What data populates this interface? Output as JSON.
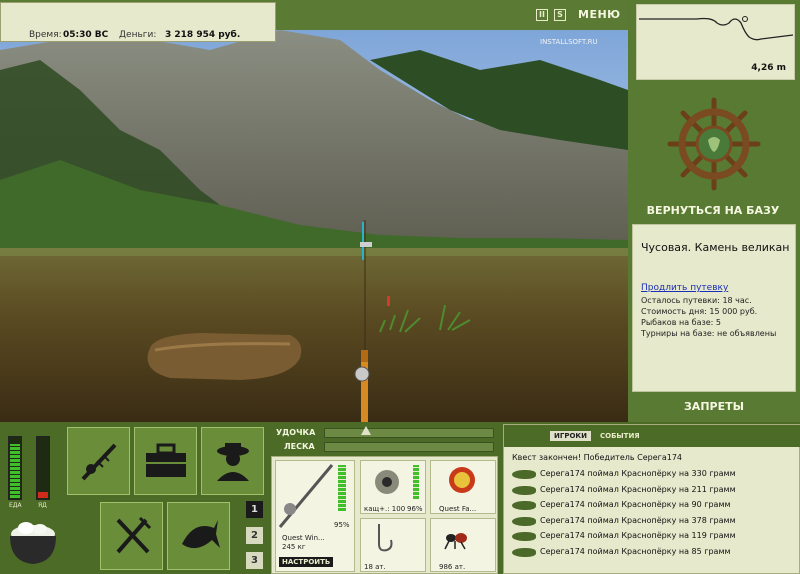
{
  "hud": {
    "time_label": "Время:",
    "time_value": "05:30 ВС",
    "money_label": "Деньги:",
    "money_value": "3 218 954 руб."
  },
  "top_controls": {
    "pause_symbol": "II",
    "sound_symbol": "S",
    "menu_label": "МЕНЮ"
  },
  "watermark": "INSTALLSOFT.RU",
  "depth": {
    "value": "4,26 m"
  },
  "right_panel": {
    "return_label": "ВЕРНУТЬСЯ НА БАЗУ",
    "location_name": "Чусовая. Камень великан",
    "extend_link": "Продлить путевку",
    "remaining": "Осталось путевки: 18 час.",
    "day_cost": "Стоимость дня: 15 000 руб.",
    "fishers": "Рыбаков на базе: 5",
    "tournaments": "Турниры на базе: не объявлены",
    "bans_label": "ЗАПРЕТЫ"
  },
  "meters": {
    "food_label": "ЕДА",
    "poison_label": "ЯД",
    "food_level": 0.9,
    "poison_level": 0.1
  },
  "rod_controls": {
    "rod_label": "УДОЧКА",
    "line_label": "ЛЕСКА",
    "configure_label": "НАСТРОИТЬ"
  },
  "tackle": {
    "rod_name": "Quest Win...",
    "rod_capacity": "245 кг",
    "rod_percent": "95%",
    "reel_name": "кащ+.: 100",
    "reel_percent": "96%",
    "line_name": "Quest Fa...",
    "hook_count": "18 ат.",
    "bait_count": "986 ат."
  },
  "slot_numbers": [
    "1",
    "2",
    "3"
  ],
  "chat": {
    "tab_players": "ИГРОКИ",
    "tab_events": "СОБЫТИЯ",
    "quest_message": "Квест закончен! Победитель Серега174",
    "catches": [
      "Серега174 поймал Краснопёрку на 330 грамм",
      "Серега174 поймал Краснопёрку на 211 грамм",
      "Серега174 поймал Краснопёрку на 90 грамм",
      "Серега174 поймал Краснопёрку на 378 грамм",
      "Серега174 поймал Краснопёрку на 119 грамм",
      "Серега174 поймал Краснопёрку на 85 грамм"
    ]
  },
  "colors": {
    "panel_green": "#597a33",
    "panel_cream": "#e7e9cc",
    "meter_green": "#3fbf2a",
    "meter_red": "#d02a1a"
  }
}
